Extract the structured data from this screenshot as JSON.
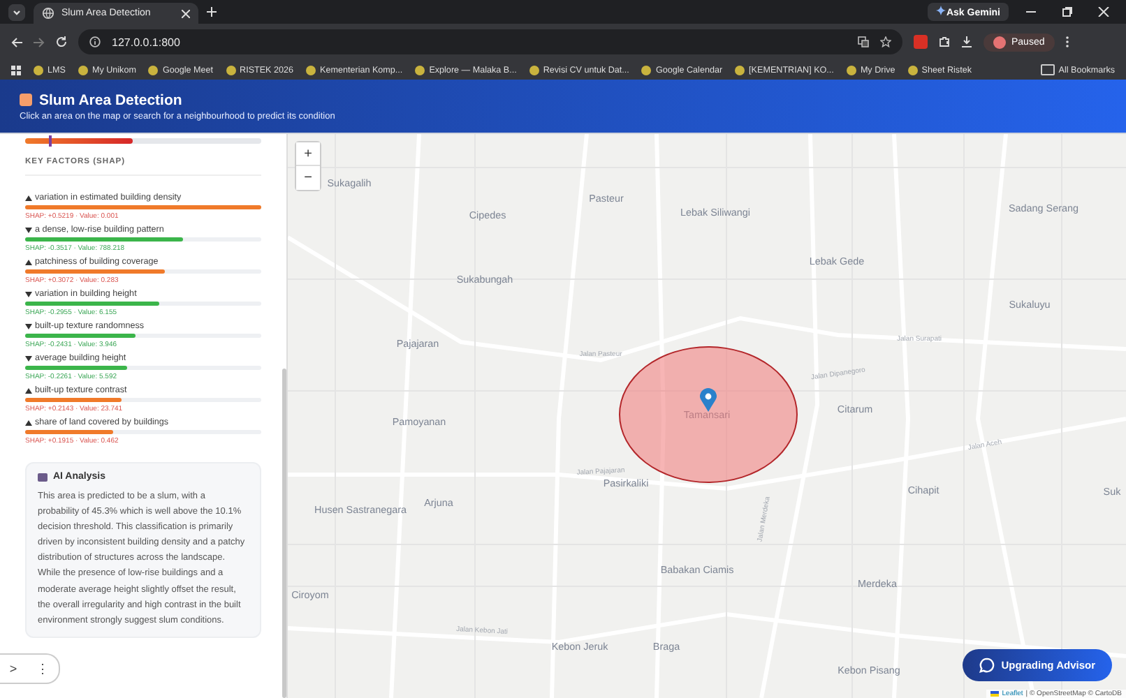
{
  "browser": {
    "tab_title": "Slum Area Detection",
    "ask_button": "Ask Gemini",
    "url": "127.0.0.1:800",
    "profile": "Paused",
    "bookmarks": [
      "LMS",
      "My Unikom",
      "Google Meet",
      "RISTEK 2026",
      "Kementerian Komp...",
      "Explore — Malaka B...",
      "Revisi CV untuk Dat...",
      "Google Calendar",
      "[KEMENTRIAN] KO...",
      "My Drive",
      "Sheet Ristek"
    ],
    "all_bookmarks": "All Bookmarks"
  },
  "header": {
    "title": "Slum Area Detection",
    "subtitle": "Click an area on the map or search for a neighbourhood to predict its condition"
  },
  "sidebar": {
    "probability": {
      "level": 0.453
    },
    "threshold_marker": {
      "level": 0.101
    },
    "factors_heading": "KEY FACTORS (SHAP)",
    "factors": [
      {
        "kind": "up",
        "label": "variation in estimated building density",
        "level": 1.0,
        "detail": "SHAP: +0.5219 · Value: 0.001"
      },
      {
        "kind": "down",
        "label": "a dense, low-rise building pattern",
        "level": 0.67,
        "detail": "SHAP: -0.3517 · Value: 788.218"
      },
      {
        "kind": "up",
        "label": "patchiness of building coverage",
        "level": 0.59,
        "detail": "SHAP: +0.3072 · Value: 0.283"
      },
      {
        "kind": "down",
        "label": "variation in building height",
        "level": 0.57,
        "detail": "SHAP: -0.2955 · Value: 6.155"
      },
      {
        "kind": "down",
        "label": "built-up texture randomness",
        "level": 0.47,
        "detail": "SHAP: -0.2431 · Value: 3.946"
      },
      {
        "kind": "down",
        "label": "average building height",
        "level": 0.43,
        "detail": "SHAP: -0.2261 · Value: 5.592"
      },
      {
        "kind": "up",
        "label": "built-up texture contrast",
        "level": 0.41,
        "detail": "SHAP: +0.2143 · Value: 23.741"
      },
      {
        "kind": "up",
        "label": "share of land covered by buildings",
        "level": 0.37,
        "detail": "SHAP: +0.1915 · Value: 0.462"
      }
    ],
    "analysis": {
      "title": "AI Analysis",
      "text": "This area is predicted to be a slum, with a probability of 45.3% which is well above the 10.1% decision threshold. This classification is primarily driven by inconsistent building density and a patchy distribution of structures across the landscape. While the presence of low-rise buildings and a moderate average height slightly offset the result, the overall irregularity and high contrast in the built environment strongly suggest slum conditions."
    }
  },
  "map": {
    "zoom_in": "+",
    "zoom_out": "−",
    "places": [
      "Sukagalih",
      "Pasteur",
      "Cipedes",
      "Lebak Siliwangi",
      "Sadang Serang",
      "Lebak Gede",
      "Sukabungah",
      "Sukaluyu",
      "Pajajaran",
      "Citarum",
      "Pamoyanan",
      "Tamansari",
      "Pasirkaliki",
      "Cihapit",
      "Arjuna",
      "Husen Sastranegara",
      "Babakan Ciamis",
      "Merdeka",
      "Ciroyom",
      "Kebon Jeruk",
      "Braga",
      "Kebon Pisang",
      "Suk"
    ],
    "streets": [
      "Jalan Pasteur",
      "Jalan Surapati",
      "Jalan Dipanegoro",
      "Jalan Pajajaran",
      "Jalan Kebon Jati",
      "Jalan Aceh",
      "Jalan Merdeka"
    ],
    "advisor_button": "Upgrading Advisor",
    "attribution_link": "Leaflet",
    "attribution": "| © OpenStreetMap © CartoDB"
  },
  "overlay": {
    "expand": ">",
    "more": "⋮"
  }
}
